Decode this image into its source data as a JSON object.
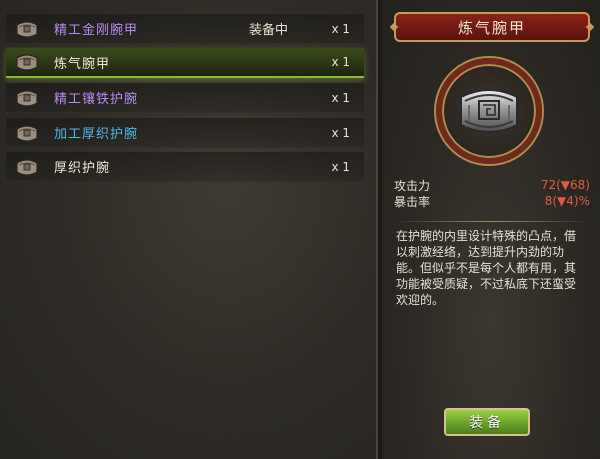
{
  "inventory": {
    "items": [
      {
        "name": "精工金刚腕甲",
        "status": "装备中",
        "count": "x 1",
        "name_color": "#b48cf0",
        "icon": "armguard-icon"
      },
      {
        "name": "炼气腕甲",
        "status": "",
        "count": "x 1",
        "name_color": "#f0ead8",
        "icon": "armguard-icon"
      },
      {
        "name": "精工镶铁护腕",
        "status": "",
        "count": "x 1",
        "name_color": "#b48cf0",
        "icon": "armguard-icon"
      },
      {
        "name": "加工厚织护腕",
        "status": "",
        "count": "x 1",
        "name_color": "#4fb8ea",
        "icon": "armguard-icon"
      },
      {
        "name": "厚织护腕",
        "status": "",
        "count": "x 1",
        "name_color": "#f0ead8",
        "icon": "armguard-icon"
      }
    ],
    "selected_index": 1
  },
  "detail": {
    "title": "炼气腕甲",
    "portrait_icon": "armguard-icon",
    "stats": [
      {
        "label": "攻击力",
        "value": "72(▼68)"
      },
      {
        "label": "暴击率",
        "value": "8(▼4)%"
      }
    ],
    "description": "在护腕的内里设计特殊的凸点，借以刺激经络，达到提升内劲的功能。但似乎不是每个人都有用，其功能被受质疑，不过私底下还蛮受欢迎的。",
    "equip_label": "装备"
  },
  "colors": {
    "selected_highlight": "#8db83a",
    "stat_value": "#e05a44",
    "title_bg": "#8a231a",
    "button_green": "#6aa22a"
  }
}
